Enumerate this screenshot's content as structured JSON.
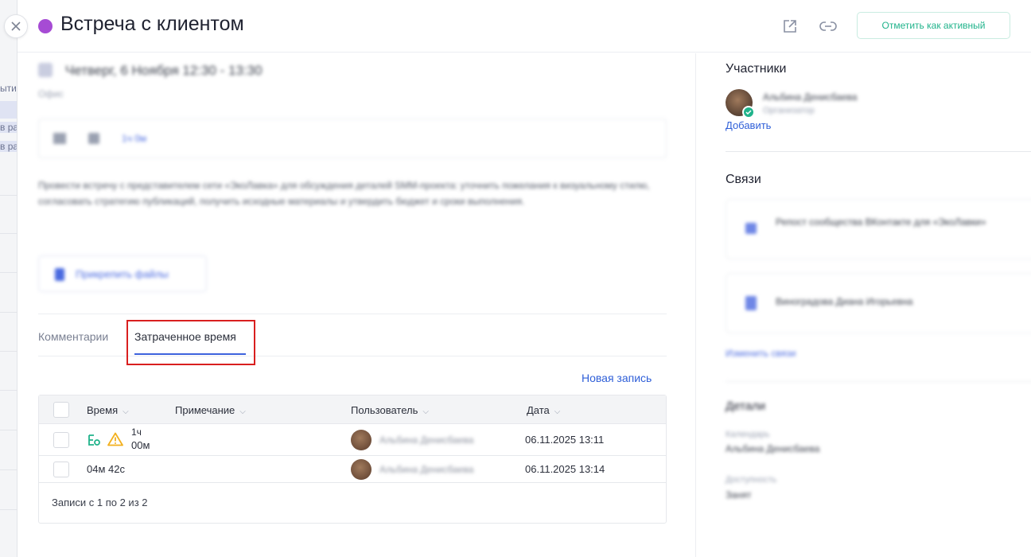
{
  "backdrop": {
    "rows": [
      "ыти",
      "в ра",
      "в ра"
    ]
  },
  "header": {
    "title": "Встреча с клиентом",
    "status_color": "#a64bd4",
    "activate_label": "Отметить как активный",
    "icons": [
      "external-link-icon",
      "link-icon",
      "close-icon"
    ]
  },
  "event": {
    "datetime": "Четверг, 6 Ноября 12:30 - 13:30",
    "location": "Офис",
    "online_label": "1ч 0м",
    "description": "Провести встречу с представителем сети «ЭкоЛавка» для обсуждения деталей SMM-проекта: уточнить пожелания к визуальному стилю, согласовать стратегию публикаций, получить исходные материалы и утвердить бюджет и сроки выполнения.",
    "attach_label": "Прикрепить файлы"
  },
  "tabs": {
    "comments": "Комментарии",
    "time": "Затраченное время"
  },
  "time_table": {
    "new_entry_label": "Новая запись",
    "columns": {
      "time": "Время",
      "note": "Примечание",
      "user": "Пользователь",
      "date": "Дата"
    },
    "rows": [
      {
        "time_line1": "1ч",
        "time_line2": "00м",
        "user": "Альбина Денисбаева",
        "date": "06.11.2025 13:11"
      },
      {
        "time": "04м 42с",
        "user": "Альбина Денисбаева",
        "date": "06.11.2025 13:14"
      }
    ],
    "footer": "Записи с 1 по 2 из 2",
    "accent_green": "#20b38b",
    "warning_color": "#f2b01e"
  },
  "participants": {
    "title": "Участники",
    "name": "Альбина Денисбаева",
    "role": "Организатор",
    "add_label": "Добавить"
  },
  "links": {
    "title": "Связи",
    "items": [
      "Репост сообщества ВКонтакте для «ЭкоЛавки»",
      "Виноградова Диана Игорьевна"
    ],
    "change_label": "Изменить связи"
  },
  "details": {
    "title": "Детали",
    "calendar_label": "Календарь",
    "calendar_value": "Альбина Денисбаева",
    "availability_label": "Доступность",
    "availability_value": "Занят"
  }
}
